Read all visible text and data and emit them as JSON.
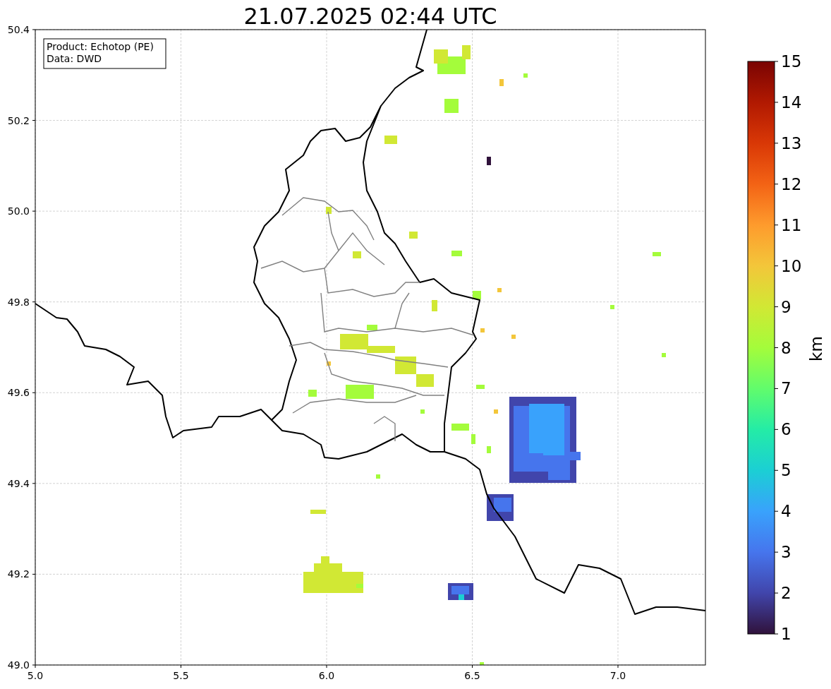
{
  "title": "21.07.2025 02:44 UTC",
  "info_box": {
    "lines": [
      "Product: Echotop (PE)",
      "Data: DWD"
    ]
  },
  "map": {
    "xticks": [
      "5.0",
      "5.5",
      "6.0",
      "6.5",
      "7.0"
    ],
    "yticks": [
      "50.4",
      "50.2",
      "50.0",
      "49.8",
      "49.6",
      "49.4",
      "49.2",
      "49.0"
    ]
  },
  "colorbar": {
    "label": "km",
    "ticks": [
      "15",
      "14",
      "13",
      "12",
      "11",
      "10",
      "9",
      "8",
      "7",
      "6",
      "5",
      "4",
      "3",
      "2",
      "1"
    ]
  }
}
